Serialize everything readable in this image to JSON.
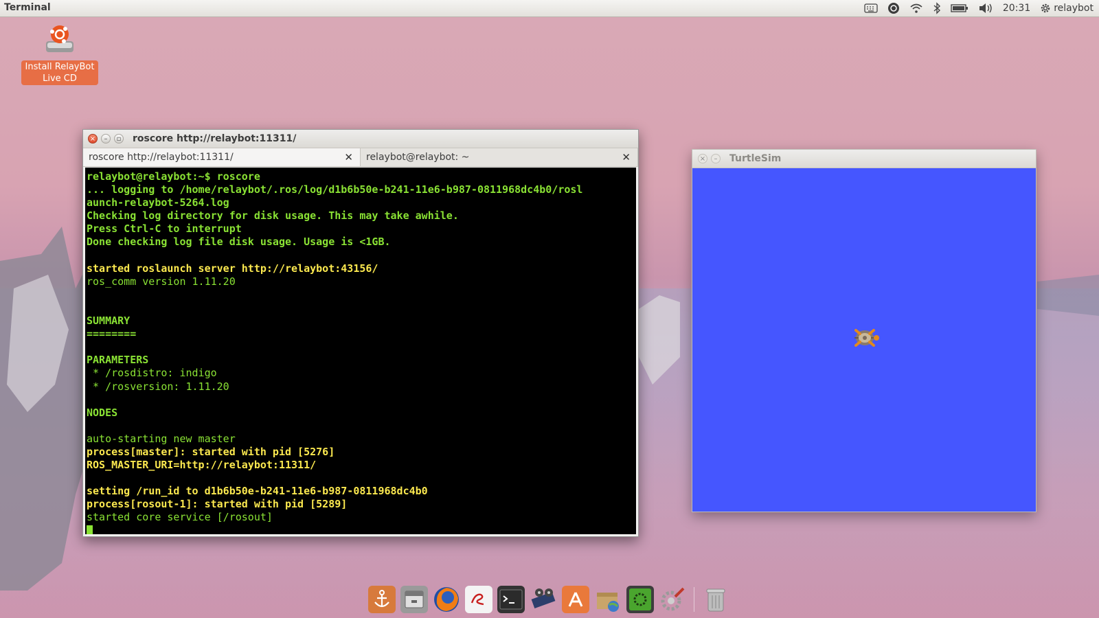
{
  "top_panel": {
    "app_title": "Terminal",
    "clock": "20:31",
    "user": "relaybot",
    "indicator_icons": [
      "keyboard-icon",
      "updates-icon",
      "wifi-icon",
      "bluetooth-icon",
      "battery-icon",
      "volume-icon"
    ]
  },
  "desktop": {
    "icon_label": "Install RelayBot Live CD"
  },
  "terminal": {
    "title": "roscore http://relaybot:11311/",
    "tabs": [
      {
        "label": "roscore http://relaybot:11311/",
        "active": true
      },
      {
        "label": "relaybot@relaybot: ~",
        "active": false
      }
    ],
    "lines": [
      {
        "text": "relaybot@relaybot:~$ roscore",
        "style": "green-bold"
      },
      {
        "text": "... logging to /home/relaybot/.ros/log/d1b6b50e-b241-11e6-b987-0811968dc4b0/rosl",
        "style": "green-bold"
      },
      {
        "text": "aunch-relaybot-5264.log",
        "style": "green-bold"
      },
      {
        "text": "Checking log directory for disk usage. This may take awhile.",
        "style": "green-bold"
      },
      {
        "text": "Press Ctrl-C to interrupt",
        "style": "green-bold"
      },
      {
        "text": "Done checking log file disk usage. Usage is <1GB.",
        "style": "green-bold"
      },
      {
        "text": "",
        "style": "green"
      },
      {
        "text": "started roslaunch server http://relaybot:43156/",
        "style": "yellow-bold"
      },
      {
        "text": "ros_comm version 1.11.20",
        "style": "green"
      },
      {
        "text": "",
        "style": "green"
      },
      {
        "text": "",
        "style": "green"
      },
      {
        "text": "SUMMARY",
        "style": "green-bold"
      },
      {
        "text": "========",
        "style": "green-bold"
      },
      {
        "text": "",
        "style": "green"
      },
      {
        "text": "PARAMETERS",
        "style": "green-bold"
      },
      {
        "text": " * /rosdistro: indigo",
        "style": "green"
      },
      {
        "text": " * /rosversion: 1.11.20",
        "style": "green"
      },
      {
        "text": "",
        "style": "green"
      },
      {
        "text": "NODES",
        "style": "green-bold"
      },
      {
        "text": "",
        "style": "green"
      },
      {
        "text": "auto-starting new master",
        "style": "green"
      },
      {
        "text": "process[master]: started with pid [5276]",
        "style": "yellow-bold"
      },
      {
        "text": "ROS_MASTER_URI=http://relaybot:11311/",
        "style": "yellow-bold"
      },
      {
        "text": "",
        "style": "green"
      },
      {
        "text": "setting /run_id to d1b6b50e-b241-11e6-b987-0811968dc4b0",
        "style": "yellow-bold"
      },
      {
        "text": "process[rosout-1]: started with pid [5289]",
        "style": "yellow-bold"
      },
      {
        "text": "started core service [/rosout]",
        "style": "green"
      }
    ]
  },
  "turtlesim": {
    "title": "TurtleSim",
    "background_color": "#4556ff"
  },
  "dock": {
    "items": [
      "anchor-icon",
      "file-manager-icon",
      "firefox-icon",
      "text-editor-icon",
      "terminal-icon",
      "video-editor-icon",
      "software-center-icon",
      "archive-manager-icon",
      "system-monitor-icon",
      "system-settings-icon",
      "trash-icon"
    ]
  }
}
